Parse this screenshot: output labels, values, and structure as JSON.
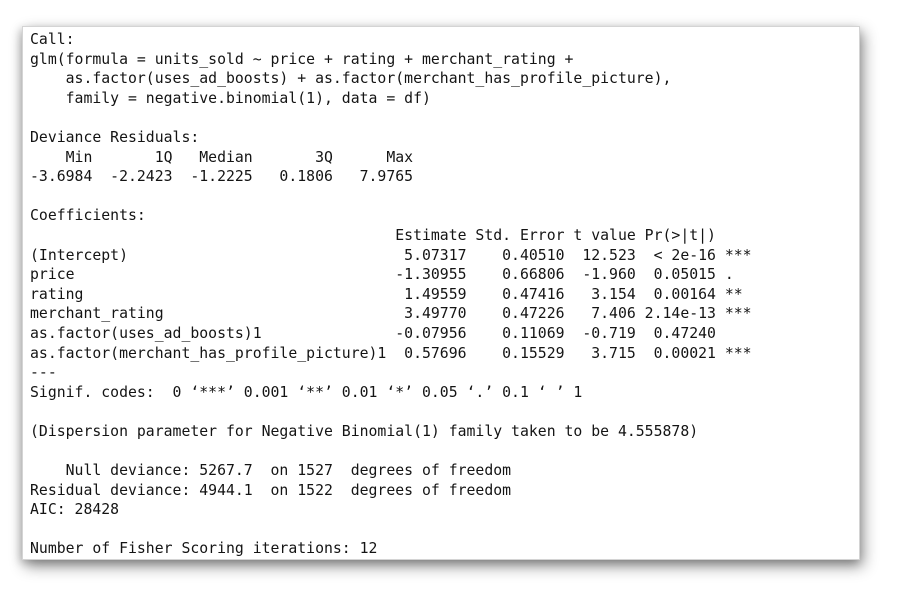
{
  "console": {
    "lines": [
      "Call:",
      "glm(formula = units_sold ~ price + rating + merchant_rating +",
      "    as.factor(uses_ad_boosts) + as.factor(merchant_has_profile_picture),",
      "    family = negative.binomial(1), data = df)",
      "",
      "Deviance Residuals:",
      "    Min       1Q   Median       3Q      Max",
      "-3.6984  -2.2423  -1.2225   0.1806   7.9765",
      "",
      "Coefficients:",
      "                                         Estimate Std. Error t value Pr(>|t|)",
      "(Intercept)                               5.07317    0.40510  12.523  < 2e-16 ***",
      "price                                    -1.30955    0.66806  -1.960  0.05015 .",
      "rating                                    1.49559    0.47416   3.154  0.00164 **",
      "merchant_rating                           3.49770    0.47226   7.406 2.14e-13 ***",
      "as.factor(uses_ad_boosts)1               -0.07956    0.11069  -0.719  0.47240",
      "as.factor(merchant_has_profile_picture)1  0.57696    0.15529   3.715  0.00021 ***",
      "---",
      "Signif. codes:  0 ‘***’ 0.001 ‘**’ 0.01 ‘*’ 0.05 ‘.’ 0.1 ‘ ’ 1",
      "",
      "(Dispersion parameter for Negative Binomial(1) family taken to be 4.555878)",
      "",
      "    Null deviance: 5267.7  on 1527  degrees of freedom",
      "Residual deviance: 4944.1  on 1522  degrees of freedom",
      "AIC: 28428",
      "",
      "Number of Fisher Scoring iterations: 12"
    ]
  }
}
